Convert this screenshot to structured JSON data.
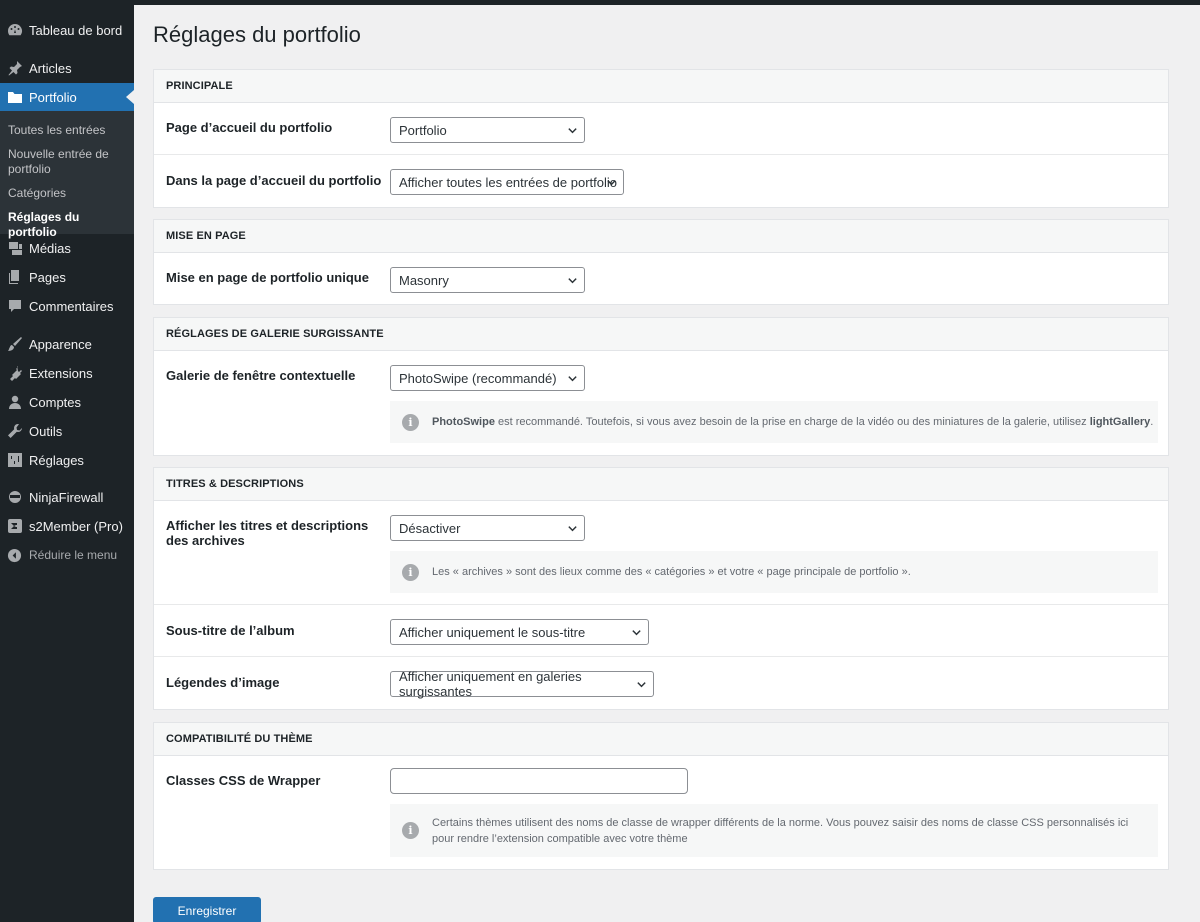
{
  "sidebar": {
    "items": [
      {
        "label": "Tableau de bord",
        "icon": "dashboard-icon"
      },
      {
        "label": "Articles",
        "icon": "pin-icon"
      },
      {
        "label": "Portfolio",
        "icon": "folder-icon"
      },
      {
        "label": "Médias",
        "icon": "media-icon"
      },
      {
        "label": "Pages",
        "icon": "pages-icon"
      },
      {
        "label": "Commentaires",
        "icon": "comment-icon"
      },
      {
        "label": "Apparence",
        "icon": "brush-icon"
      },
      {
        "label": "Extensions",
        "icon": "plugin-icon"
      },
      {
        "label": "Comptes",
        "icon": "user-icon"
      },
      {
        "label": "Outils",
        "icon": "wrench-icon"
      },
      {
        "label": "Réglages",
        "icon": "settings-icon"
      },
      {
        "label": "NinjaFirewall",
        "icon": "ninja-icon"
      },
      {
        "label": "s2Member (Pro)",
        "icon": "s2member-icon"
      }
    ],
    "submenu": [
      "Toutes les entrées",
      "Nouvelle entrée de portfolio",
      "Catégories",
      "Réglages du portfolio"
    ],
    "collapse": "Réduire le menu"
  },
  "page_title": "Réglages du portfolio",
  "sections": {
    "principale": {
      "title": "PRINCIPALE",
      "home_label": "Page d’accueil du portfolio",
      "home_value": "Portfolio",
      "inhome_label": "Dans la page d’accueil du portfolio",
      "inhome_value": "Afficher toutes les entrées de portfolio"
    },
    "mise_en_page": {
      "title": "MISE EN PAGE",
      "layout_label": "Mise en page de portfolio unique",
      "layout_value": "Masonry"
    },
    "galerie": {
      "title": "RÉGLAGES DE GALERIE SURGISSANTE",
      "popup_label": "Galerie de fenêtre contextuelle",
      "popup_value": "PhotoSwipe (recommandé)",
      "notice_strong1": "PhotoSwipe",
      "notice_text": " est recommandé. Toutefois, si vous avez besoin de la prise en charge de la vidéo ou des miniatures de la galerie, utilisez ",
      "notice_strong2": "lightGallery",
      "notice_end": "."
    },
    "titres": {
      "title": "TITRES & DESCRIPTIONS",
      "archives_label": "Afficher les titres et descriptions des archives",
      "archives_value": "Désactiver",
      "archives_notice": "Les « archives » sont des lieux comme des « catégories » et votre « page principale de portfolio ».",
      "subtitle_label": "Sous-titre de l’album",
      "subtitle_value": "Afficher uniquement le sous-titre",
      "captions_label": "Légendes d’image",
      "captions_value": "Afficher uniquement en galeries surgissantes"
    },
    "compat": {
      "title": "COMPATIBILITÉ DU THÈME",
      "wrapper_label": "Classes CSS de Wrapper",
      "wrapper_value": "",
      "wrapper_notice": "Certains thèmes utilisent des noms de classe de wrapper différents de la norme. Vous pouvez saisir des noms de classe CSS personnalisés ici pour rendre l’extension compatible avec votre thème"
    }
  },
  "save_label": "Enregistrer",
  "info_glyph": "i",
  "colors": {
    "accent": "#2271b1",
    "sidebar": "#1d2327",
    "submenu": "#2c3338"
  }
}
